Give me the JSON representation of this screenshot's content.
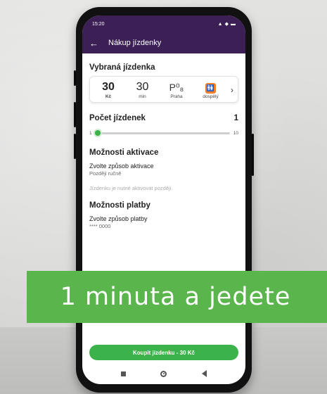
{
  "status_bar": {
    "time": "15:20",
    "signal": "▲",
    "wifi": "◆",
    "battery": "▬"
  },
  "app_bar": {
    "back_icon": "←",
    "title": "Nákup jízdenky"
  },
  "selected_ticket": {
    "heading": "Vybraná jízdenka",
    "price_value": "30",
    "price_unit": "Kč",
    "duration_value": "30",
    "duration_unit": "min",
    "zone_symbol": "P⁰₈",
    "zone_label": "Praha",
    "passenger_icon": "🚻",
    "passenger_label": "dospělý",
    "more_icon": "›"
  },
  "ticket_count": {
    "heading": "Počet jízdenek",
    "value": "1",
    "slider_min": "1",
    "slider_max": "10",
    "slider_level": 0.0
  },
  "activation": {
    "heading": "Možnosti aktivace",
    "field_label": "Zvolte způsob aktivace",
    "field_value": "Později ručně",
    "note": "Jízdenku je nutné aktivovat později."
  },
  "payment": {
    "heading": "Možnosti platby",
    "field_label": "Zvolte způsob platby",
    "field_value": "**** 0000"
  },
  "banner": {
    "text": "1 minuta a jedete"
  },
  "buy_button": {
    "label": "Koupit jízdenku - 30 Kč"
  },
  "colors": {
    "app_bar": "#3b1f55",
    "accent_green": "#3bb34a",
    "banner_green": "#59b54c",
    "passenger_orange": "#f07f2a"
  }
}
